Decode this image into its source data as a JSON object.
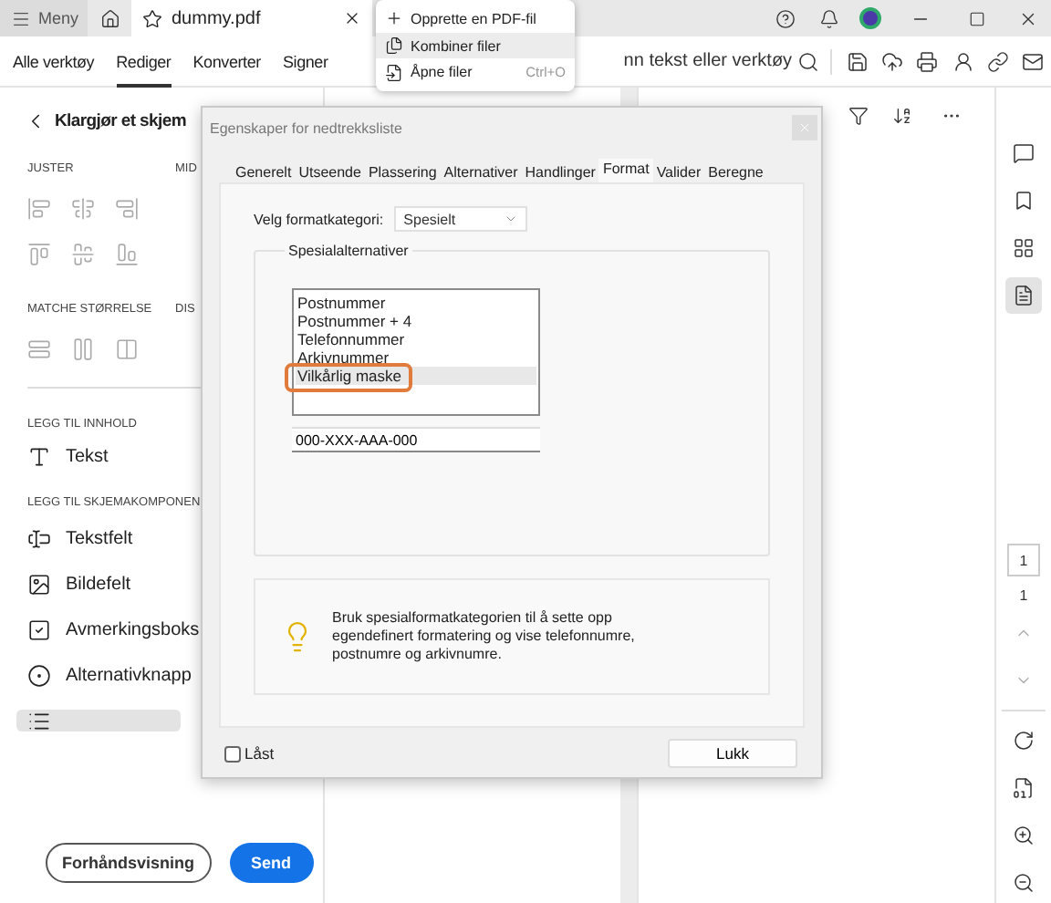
{
  "title_bar": {
    "menu_label": "Meny",
    "document_tab": {
      "title": "dummy.pdf"
    }
  },
  "toolbar": {
    "tabs": [
      {
        "label": "Alle verktøy",
        "selected": false
      },
      {
        "label": "Rediger",
        "selected": true
      },
      {
        "label": "Konverter",
        "selected": false
      },
      {
        "label": "Signer",
        "selected": false
      }
    ],
    "search": {
      "placeholder": "nn tekst eller verktøy"
    }
  },
  "left_panel": {
    "title": "Klargjør et skjem",
    "align_heading": "JUSTER",
    "middle_heading": "MID",
    "size_heading": "MATCHE STØRRELSE",
    "distribute_heading": "DIS",
    "content_heading": "LEGG TIL INNHOLD",
    "content_items": [
      {
        "label": "Tekst"
      }
    ],
    "components_heading": "LEGG TIL SKJEMAKOMPONEN",
    "components": [
      {
        "kind": "text_field",
        "label": "Tekstfelt",
        "selected": false
      },
      {
        "kind": "image_field",
        "label": "Bildefelt",
        "selected": false
      },
      {
        "kind": "checkbox",
        "label": "Avmerkingsboks",
        "selected": false
      },
      {
        "kind": "radio",
        "label": "Alternativknapp",
        "selected": false
      },
      {
        "kind": "list",
        "selected": true
      }
    ],
    "preview_button": "Forhåndsvisning",
    "send_button": "Send"
  },
  "dropdown_menu": {
    "items": [
      {
        "kind": "create",
        "label": "Opprette en PDF-fil",
        "selected": false
      },
      {
        "kind": "combine",
        "label": "Kombiner filer",
        "selected": true
      },
      {
        "kind": "open",
        "label": "Åpne filer",
        "shortcut": "Ctrl+O",
        "selected": false
      }
    ]
  },
  "dialog": {
    "title": "Egenskaper for nedtrekksliste",
    "tabs": [
      {
        "label": "Generelt",
        "selected": false
      },
      {
        "label": "Utseende",
        "selected": false
      },
      {
        "label": "Plassering",
        "selected": false
      },
      {
        "label": "Alternativer",
        "selected": false
      },
      {
        "label": "Handlinger",
        "selected": false
      },
      {
        "label": "Format",
        "selected": true
      },
      {
        "label": "Valider",
        "selected": false
      },
      {
        "label": "Beregne",
        "selected": false
      }
    ],
    "format_category": {
      "label": "Velg formatkategori:",
      "value": "Spesielt"
    },
    "special_options": {
      "legend": "Spesialalternativer",
      "options": [
        {
          "label": "Postnummer",
          "selected": false
        },
        {
          "label": "Postnummer + 4",
          "selected": false
        },
        {
          "label": "Telefonnummer",
          "selected": false
        },
        {
          "label": "Arkivnummer",
          "selected": false
        },
        {
          "label": "Vilkårlig maske",
          "selected": true
        }
      ],
      "mask_value": "000-XXX-AAA-000"
    },
    "info_text": "Bruk spesialformatkategorien til å sette opp egendefinert formatering og vise telefonnumre, postnumre og arkivnumre.",
    "locked": {
      "label": "Låst",
      "checked": false
    },
    "close_button": "Lukk"
  },
  "right_rail": {
    "tools": [
      {
        "kind": "comment",
        "selected": false
      },
      {
        "kind": "bookmark",
        "selected": false
      },
      {
        "kind": "thumbnails",
        "selected": false
      },
      {
        "kind": "page",
        "selected": true
      }
    ],
    "page_number": "1",
    "page_count": "1"
  }
}
